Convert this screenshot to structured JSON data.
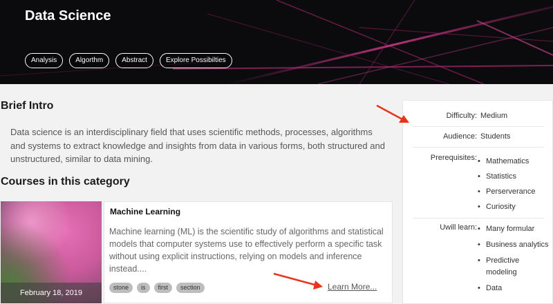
{
  "hero": {
    "title": "Data Science",
    "tags": [
      "Analysis",
      "Algorthm",
      "Abstract",
      "Explore Possibilties"
    ]
  },
  "intro": {
    "heading": "Brief Intro",
    "text": "Data science is an interdisciplinary field that uses scientific methods, processes, algorithms and systems to extract knowledge and insights from data in various forms, both structured and unstructured, similar to data mining."
  },
  "courses": {
    "heading": "Courses in this category",
    "card": {
      "date": "February 18, 2019",
      "title": "Machine Learning",
      "description": "Machine learning (ML) is the scientific study of algorithms and statistical models that computer systems use to effectively perform a specific task without using explicit instructions, relying on models and inference instead....",
      "tags": [
        "stone",
        "is",
        "first",
        "section"
      ],
      "learn_more": "Learn More..."
    }
  },
  "sidebar": {
    "difficulty_label": "Difficulty:",
    "difficulty_value": "Medium",
    "audience_label": "Audience:",
    "audience_value": "Students",
    "prerequisites_label": "Prerequisites:",
    "prerequisites": [
      "Mathematics",
      "Statistics",
      "Perserverance",
      "Curiosity"
    ],
    "learn_label": "Uwill learn:",
    "learn": [
      "Many formular",
      "Business analytics",
      "Predictive modeling",
      "Data"
    ]
  },
  "colors": {
    "annotation_arrow": "#e8341c",
    "hero_background": "#0b0b0e",
    "hero_streak": "#c2307f"
  }
}
